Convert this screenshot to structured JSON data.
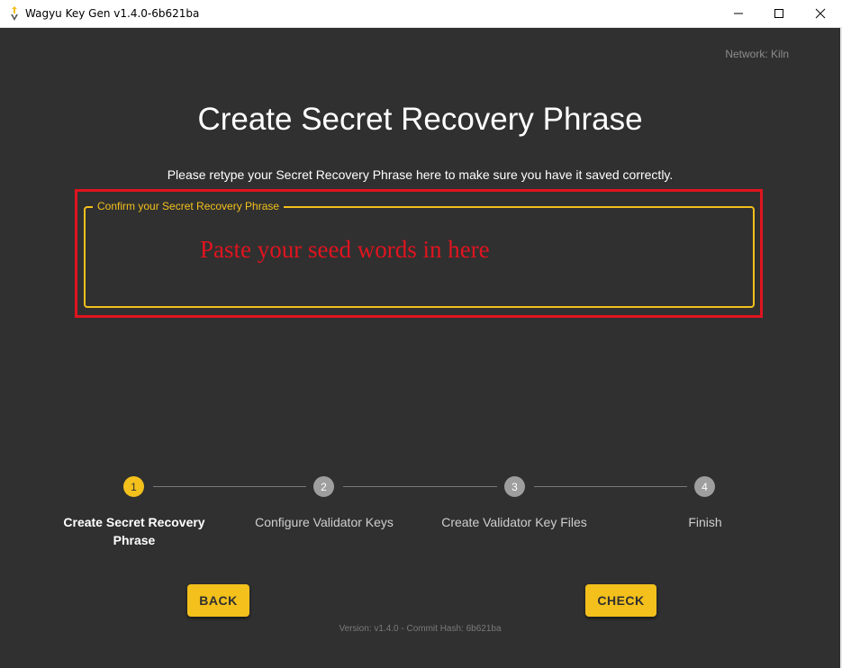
{
  "window": {
    "title": "Wagyu Key Gen v1.4.0-6b621ba",
    "icons": {
      "app": "wagyu-icon",
      "minimize": "minimize-icon",
      "maximize": "maximize-icon",
      "close": "close-icon"
    }
  },
  "header": {
    "network": "Network: Kiln"
  },
  "main": {
    "title": "Create Secret Recovery Phrase",
    "instructions": "Please retype your Secret Recovery Phrase here to make sure you have it saved correctly.",
    "phrase_field": {
      "label": "Confirm your Secret Recovery Phrase",
      "value": ""
    },
    "annotation": "Paste your seed words in here"
  },
  "stepper": {
    "steps": [
      {
        "number": "1",
        "label": "Create Secret Recovery Phrase",
        "state": "active"
      },
      {
        "number": "2",
        "label": "Configure Validator Keys",
        "state": "inactive"
      },
      {
        "number": "3",
        "label": "Create Validator Key Files",
        "state": "inactive"
      },
      {
        "number": "4",
        "label": "Finish",
        "state": "inactive"
      }
    ]
  },
  "actions": {
    "back_label": "BACK",
    "check_label": "CHECK"
  },
  "footer": {
    "version": "Version: v1.4.0 - Commit Hash: 6b621ba"
  },
  "colors": {
    "accent": "#f3c01c",
    "background": "#303030",
    "annotation": "#e0141f"
  }
}
